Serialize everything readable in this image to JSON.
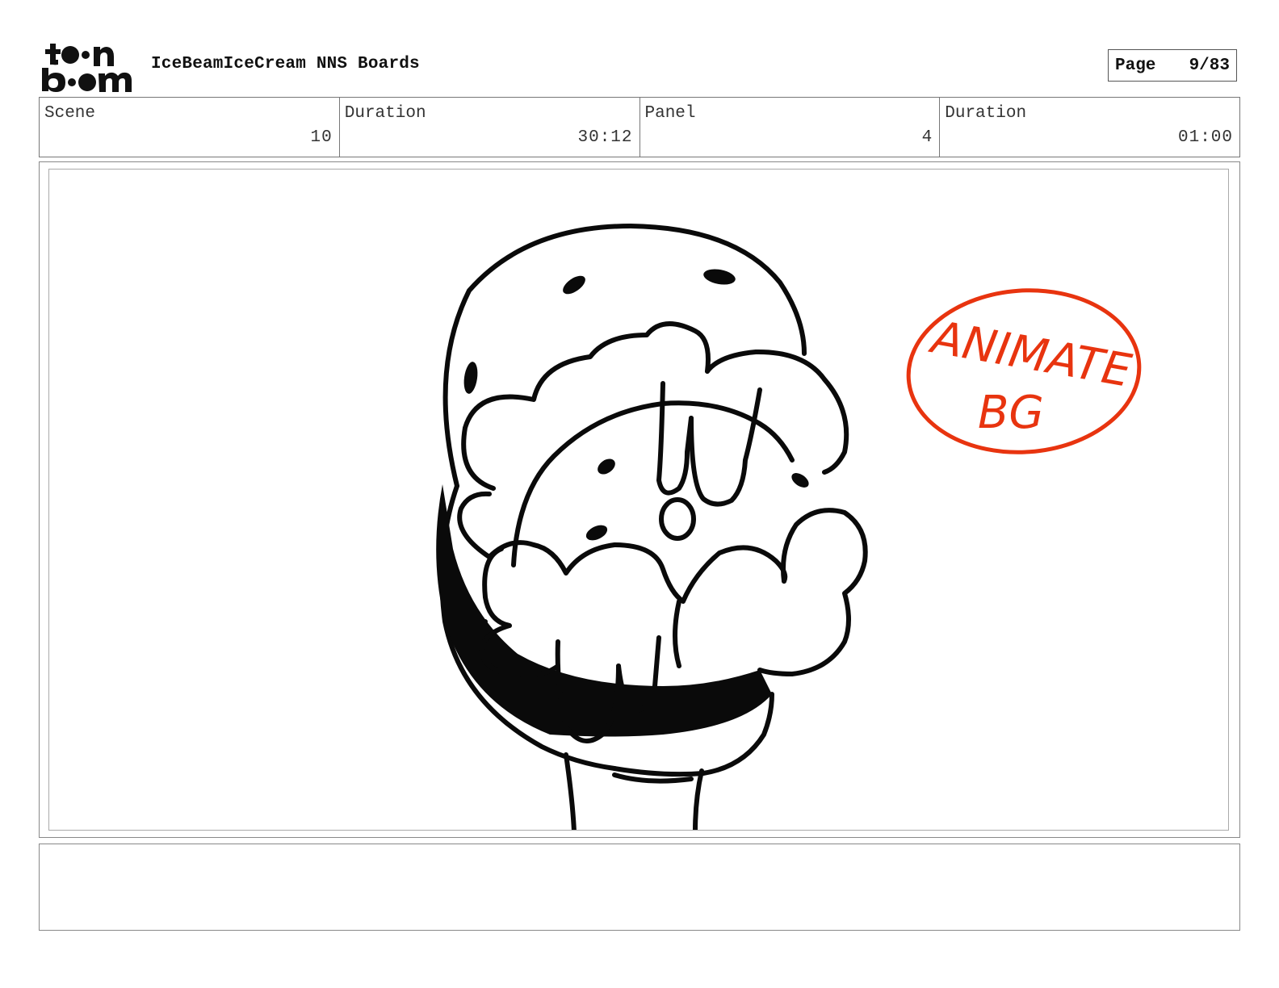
{
  "header": {
    "logo_text": "toon boom",
    "title": "IceBeamIceCream NNS Boards",
    "page_label": "Page",
    "page_value": "9/83"
  },
  "info": {
    "scene_label": "Scene",
    "scene_value": "10",
    "duration_label": "Duration",
    "duration_value": "30:12",
    "panel_label": "Panel",
    "panel_value": "4",
    "panel_duration_label": "Duration",
    "panel_duration_value": "01:00"
  },
  "drawing": {
    "note_line1": "ANIMATE",
    "note_line2": "BG",
    "note_color": "#e8340f"
  },
  "caption": {
    "text": ""
  }
}
